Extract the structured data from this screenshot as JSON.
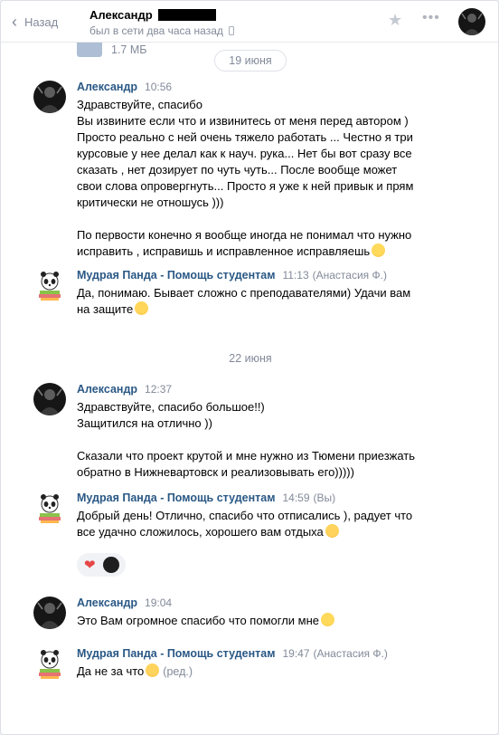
{
  "header": {
    "back_label": "Назад",
    "peer_name": "Александр",
    "peer_status": "был в сети два часа назад"
  },
  "file": {
    "size": "1.7 МБ"
  },
  "dates": {
    "d1": "19 июня",
    "d2": "22 июня"
  },
  "messages": [
    {
      "author": "Александр",
      "time": "10:56",
      "sub": "",
      "paragraphs": [
        "Здравствуйте, спасибо\nВы извините если что и извинитесь от меня перед автором )\nПросто реально с ней очень тяжело работать ... Честно я три\nкурсовые у нее делал как к науч. рука... Нет бы вот сразу все\nсказать , нет дозирует по чуть чуть... После вообще может\nсвои слова опровергнуть... Просто я уже к ней привык и прям\nкритически не отношусь )))",
        "По первости конечно я вообще иногда не понимал что нужно\nисправить , исправишь и исправленное исправляешь"
      ]
    },
    {
      "author": "Мудрая Панда - Помощь студентам",
      "time": "11:13",
      "sub": "(Анастасия Ф.)",
      "paragraphs": [
        "Да, понимаю. Бывает сложно с преподавателями) Удачи вам\nна защите"
      ]
    },
    {
      "author": "Александр",
      "time": "12:37",
      "sub": "",
      "paragraphs": [
        "Здравствуйте, спасибо большое!!)\nЗащитился на отлично ))",
        "Сказали что проект крутой и мне нужно из Тюмени приезжать\nобратно в Нижневартовск и реализовывать его)))))"
      ]
    },
    {
      "author": "Мудрая Панда - Помощь студентам",
      "time": "14:59",
      "sub": "(Вы)",
      "paragraphs": [
        "Добрый день! Отлично, спасибо что отписались ), радует что\nвсе удачно сложилось, хорошего вам отдыха"
      ]
    },
    {
      "author": "Александр",
      "time": "19:04",
      "sub": "",
      "paragraphs": [
        "Это Вам огромное спасибо что помогли мне"
      ]
    },
    {
      "author": "Мудрая Панда - Помощь студентам",
      "time": "19:47",
      "sub": "(Анастасия Ф.)",
      "paragraphs": [
        "Да не за что"
      ],
      "edited": "(ред.)"
    }
  ],
  "icons": {
    "back": "chevron-left-icon",
    "star": "star-icon",
    "more": "more-icon",
    "phone": "phone-icon",
    "file": "file-icon",
    "heart": "heart-icon"
  },
  "colors": {
    "author": "#2a5885",
    "muted": "#828a99",
    "heart": "#e64646"
  }
}
